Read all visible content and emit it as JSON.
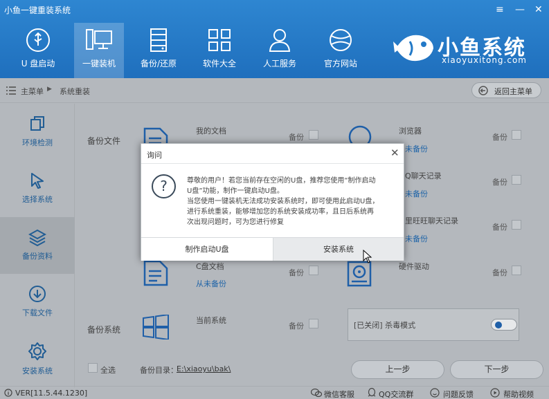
{
  "app_title": "小鱼一键重装系统",
  "window_controls": {
    "menu": "≡",
    "minimize": "—",
    "close": "✕"
  },
  "nav": [
    {
      "label": "U 盘启动",
      "icon": "usb-icon"
    },
    {
      "label": "一键装机",
      "icon": "monitor-icon",
      "active": true
    },
    {
      "label": "备份/还原",
      "icon": "server-icon"
    },
    {
      "label": "软件大全",
      "icon": "grid-icon"
    },
    {
      "label": "人工服务",
      "icon": "person-icon"
    },
    {
      "label": "官方网站",
      "icon": "globe-icon"
    }
  ],
  "brand": {
    "name": "小鱼系统",
    "url": "xiaoyuxitong.com"
  },
  "breadcrumb": {
    "root": "主菜单",
    "current": "系统重装"
  },
  "back_button": "返回主菜单",
  "sidebar": [
    {
      "label": "环境检测",
      "icon": "copy-icon"
    },
    {
      "label": "选择系统",
      "icon": "cursor-icon"
    },
    {
      "label": "备份资料",
      "icon": "layers-icon",
      "active": true
    },
    {
      "label": "下载文件",
      "icon": "download-icon"
    },
    {
      "label": "安装系统",
      "icon": "settings-icon"
    }
  ],
  "backup_files": {
    "section_label": "备份文件",
    "items_left": [
      {
        "name": "我的文档"
      },
      {
        "name": "C盘文档",
        "status": "从未备份"
      }
    ],
    "items_right": [
      {
        "name": "浏览器",
        "status": "未备份"
      },
      {
        "name": "Q聊天记录",
        "status": "未备份"
      },
      {
        "name": "里旺旺聊天记录",
        "status": "未备份"
      },
      {
        "name": "硬件驱动"
      }
    ],
    "backup_label": "备份"
  },
  "backup_system": {
    "section_label": "备份系统",
    "item": "当前系统",
    "backup_label": "备份"
  },
  "antivirus": {
    "label": "[已关闭] 杀毒模式",
    "enabled": true
  },
  "footer": {
    "select_all": "全选",
    "dir_label": "备份目录：",
    "dir_value": "E:\\xiaoyu\\bak\\",
    "prev": "上一步",
    "next": "下一步"
  },
  "statusbar": {
    "version": "VER[11.5.44.1230]",
    "links": [
      "微信客服",
      "QQ交流群",
      "问题反馈",
      "帮助视频"
    ]
  },
  "dialog": {
    "title": "询问",
    "lines": [
      "尊敬的用户！若您当前存在空闲的U盘，推荐您使用“制作启动",
      "U盘”功能，制作一键启动U盘。",
      "当您使用一键装机无法成功安装系统时，即可使用此启动U盘，",
      "进行系统重装，能够增加您的系统安装成功率，且日后系统再",
      "次出现问题时，可为您进行修复"
    ],
    "button_make_usb": "制作启动U盘",
    "button_install": "安装系统"
  },
  "colors": {
    "header": "#2279c7",
    "accent": "#1f64a8",
    "overlay": "#b4b8bd"
  }
}
